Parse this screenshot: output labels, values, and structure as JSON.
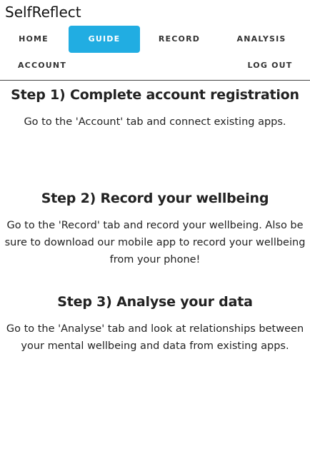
{
  "header": {
    "brand": "SelfReflect"
  },
  "nav": {
    "home": "HOME",
    "guide": "GUIDE",
    "record": "RECORD",
    "analysis": "ANALYSIS",
    "account": "ACCOUNT",
    "logout": "LOG OUT",
    "active": "GUIDE",
    "active_color": "#21ade2"
  },
  "guide": {
    "steps": [
      {
        "title": "Step 1) Complete account registration",
        "text": "Go to the 'Account' tab and connect existing apps."
      },
      {
        "title": "Step 2) Record your wellbeing",
        "text": "Go to the 'Record' tab and record your wellbeing. Also be sure to download our mobile app to record your wellbeing from your phone!"
      },
      {
        "title": "Step 3) Analyse your data",
        "text": "Go to the 'Analyse' tab and look at relationships between your mental wellbeing and data from existing apps."
      }
    ]
  }
}
